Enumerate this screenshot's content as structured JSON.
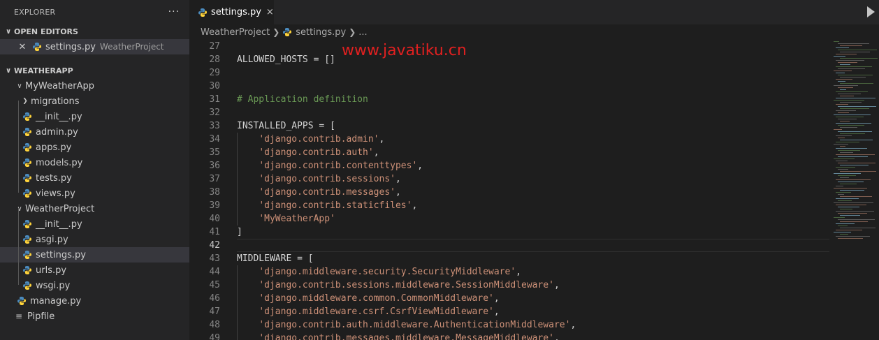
{
  "sidebar": {
    "title": "EXPLORER",
    "more": "···",
    "open_editors_label": "OPEN EDITORS",
    "open_editor": {
      "file": "settings.py",
      "folder": "WeatherProject"
    },
    "workspace_label": "WEATHERAPP",
    "tree": [
      {
        "label": "MyWeatherApp",
        "type": "folder-open",
        "depth": 1
      },
      {
        "label": "migrations",
        "type": "folder-closed",
        "depth": 2
      },
      {
        "label": "__init__.py",
        "type": "py",
        "depth": 2
      },
      {
        "label": "admin.py",
        "type": "py",
        "depth": 2
      },
      {
        "label": "apps.py",
        "type": "py",
        "depth": 2
      },
      {
        "label": "models.py",
        "type": "py",
        "depth": 2
      },
      {
        "label": "tests.py",
        "type": "py",
        "depth": 2
      },
      {
        "label": "views.py",
        "type": "py",
        "depth": 2
      },
      {
        "label": "WeatherProject",
        "type": "folder-open",
        "depth": 1
      },
      {
        "label": "__init__.py",
        "type": "py",
        "depth": 2
      },
      {
        "label": "asgi.py",
        "type": "py",
        "depth": 2
      },
      {
        "label": "settings.py",
        "type": "py",
        "depth": 2,
        "selected": true
      },
      {
        "label": "urls.py",
        "type": "py",
        "depth": 2
      },
      {
        "label": "wsgi.py",
        "type": "py",
        "depth": 2
      },
      {
        "label": "manage.py",
        "type": "py",
        "depth": 1
      },
      {
        "label": "Pipfile",
        "type": "text",
        "depth": 1
      }
    ]
  },
  "tab": {
    "label": "settings.py",
    "close": "×"
  },
  "breadcrumb": {
    "folder": "WeatherProject",
    "file": "settings.py",
    "rest": "..."
  },
  "watermark": "www.javatiku.cn",
  "editor": {
    "current_line": 42,
    "lines": [
      {
        "n": "27",
        "t": ""
      },
      {
        "n": "28",
        "t": "ALLOWED_HOSTS = []"
      },
      {
        "n": "29",
        "t": ""
      },
      {
        "n": "30",
        "t": ""
      },
      {
        "n": "31",
        "t": "# Application definition",
        "cls": "cmt"
      },
      {
        "n": "32",
        "t": ""
      },
      {
        "n": "33",
        "t": "INSTALLED_APPS = ["
      },
      {
        "n": "34",
        "t": "'django.contrib.admin'",
        "pre": "    ",
        "post": ",",
        "cls": "str"
      },
      {
        "n": "35",
        "t": "'django.contrib.auth'",
        "pre": "    ",
        "post": ",",
        "cls": "str"
      },
      {
        "n": "36",
        "t": "'django.contrib.contenttypes'",
        "pre": "    ",
        "post": ",",
        "cls": "str"
      },
      {
        "n": "37",
        "t": "'django.contrib.sessions'",
        "pre": "    ",
        "post": ",",
        "cls": "str"
      },
      {
        "n": "38",
        "t": "'django.contrib.messages'",
        "pre": "    ",
        "post": ",",
        "cls": "str"
      },
      {
        "n": "39",
        "t": "'django.contrib.staticfiles'",
        "pre": "    ",
        "post": ",",
        "cls": "str"
      },
      {
        "n": "40",
        "t": "'MyWeatherApp'",
        "pre": "    ",
        "post": "",
        "cls": "str"
      },
      {
        "n": "41",
        "t": "]"
      },
      {
        "n": "42",
        "t": ""
      },
      {
        "n": "43",
        "t": "MIDDLEWARE = ["
      },
      {
        "n": "44",
        "t": "'django.middleware.security.SecurityMiddleware'",
        "pre": "    ",
        "post": ",",
        "cls": "str"
      },
      {
        "n": "45",
        "t": "'django.contrib.sessions.middleware.SessionMiddleware'",
        "pre": "    ",
        "post": ",",
        "cls": "str"
      },
      {
        "n": "46",
        "t": "'django.middleware.common.CommonMiddleware'",
        "pre": "    ",
        "post": ",",
        "cls": "str"
      },
      {
        "n": "47",
        "t": "'django.middleware.csrf.CsrfViewMiddleware'",
        "pre": "    ",
        "post": ",",
        "cls": "str"
      },
      {
        "n": "48",
        "t": "'django.contrib.auth.middleware.AuthenticationMiddleware'",
        "pre": "    ",
        "post": ",",
        "cls": "str"
      },
      {
        "n": "49",
        "t": "'django.contrib.messages.middleware.MessageMiddleware'",
        "pre": "    ",
        "post": ",",
        "cls": "str"
      }
    ]
  },
  "colors": {
    "py_blue": "#4b8bbe",
    "py_yellow": "#ffd43b",
    "string": "#ce9178",
    "comment": "#6a9955",
    "watermark": "#e02020"
  }
}
